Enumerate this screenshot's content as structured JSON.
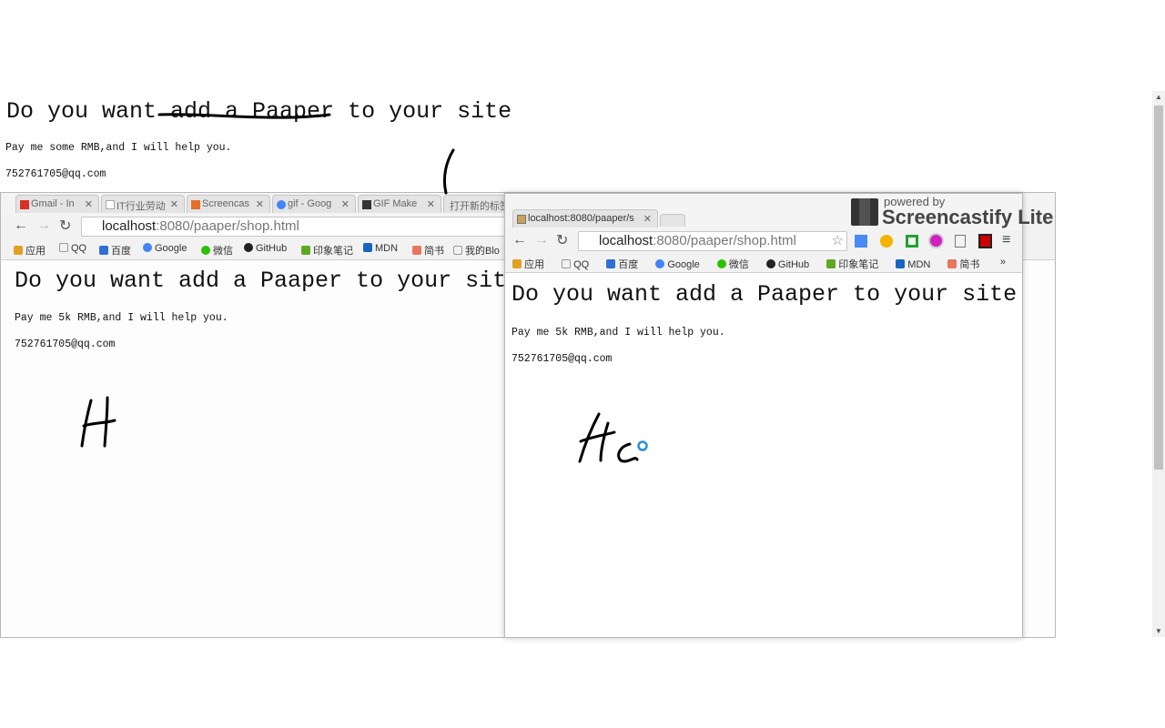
{
  "page": {
    "title": "Do you want add a Paaper to your site",
    "line1": "Pay me some RMB,and I will help you.",
    "line2": "752761705@qq.com"
  },
  "back_window": {
    "tabs": [
      {
        "label": "Gmail - In",
        "icon": "gmail-icon"
      },
      {
        "label": "IT行业劳动",
        "icon": "page-icon"
      },
      {
        "label": "Screencas",
        "icon": "screencastify-icon"
      },
      {
        "label": "gif - Goog",
        "icon": "google-icon"
      },
      {
        "label": "GIF Make",
        "icon": "gif-maker-icon"
      },
      {
        "label": "打开新的标签",
        "icon": "page-icon"
      }
    ],
    "url_host": "localhost",
    "url_rest": ":8080/paaper/shop.html",
    "bookmarks": [
      "应用",
      "QQ",
      "百度",
      "Google",
      "微信",
      "GitHub",
      "印象笔记",
      "MDN",
      "简书",
      "我的Blo"
    ],
    "content": {
      "title": "Do you want add a Paaper to your site",
      "line1": "Pay me 5k RMB,and I will help you.",
      "line2": "752761705@qq.com"
    }
  },
  "front_window": {
    "tab": {
      "label": "localhost:8080/paaper/s"
    },
    "url_host": "localhost",
    "url_rest": ":8080/paaper/shop.html",
    "bookmarks": [
      "应用",
      "QQ",
      "百度",
      "Google",
      "微信",
      "GitHub",
      "印象笔记",
      "MDN",
      "简书"
    ],
    "overflow": "»",
    "content": {
      "title": "Do you want add a Paaper to your site",
      "line1": "Pay me 5k RMB,and I will help you.",
      "line2": "752761705@qq.com"
    }
  },
  "watermark": {
    "powered": "powered by",
    "brand": "Screencastify Lite"
  },
  "bookmark_colors": [
    "#e0a020",
    "#999",
    "#2f6fd6",
    "#4285f4",
    "#2dc100",
    "#222",
    "#5fa822",
    "#1665c0",
    "#e8755f",
    "#999"
  ]
}
